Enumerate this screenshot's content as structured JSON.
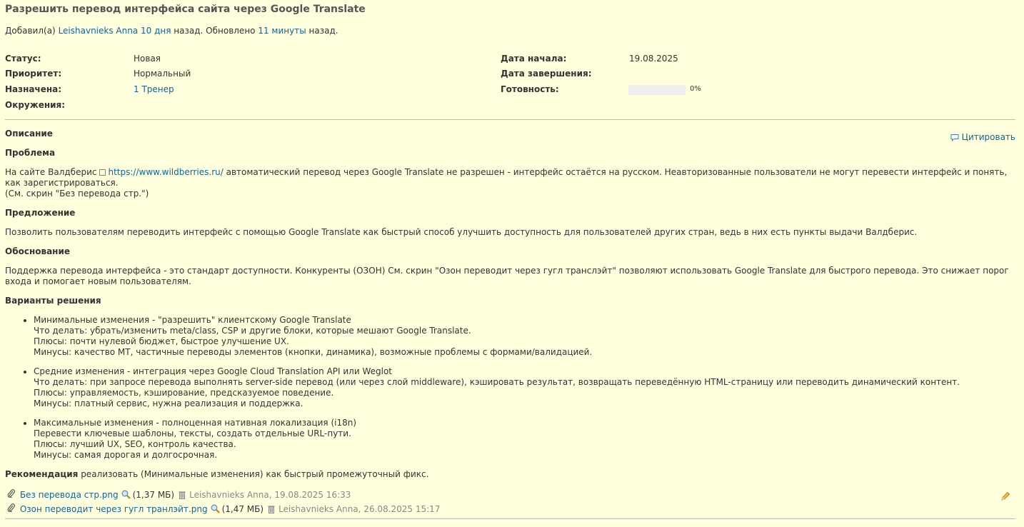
{
  "issue": {
    "subject": "Разрешить перевод интерфейса сайта через Google Translate",
    "author_line": {
      "prefix": "Добавил(а)",
      "author": "Leishavnieks Anna",
      "created_ago": "10 дня",
      "mid": "назад. Обновлено",
      "updated_ago": "11 минуты",
      "suffix": "назад."
    },
    "attributes": {
      "status_label": "Статус:",
      "status_value": "Новая",
      "priority_label": "Приоритет:",
      "priority_value": "Нормальный",
      "assigned_label": "Назначена:",
      "assigned_value": "1 Тренер",
      "environment_label": "Окружения:",
      "start_label": "Дата начала:",
      "start_value": "19.08.2025",
      "due_label": "Дата завершения:",
      "done_label": "Готовность:",
      "done_value": "0%",
      "done_ratio": 0
    },
    "description": {
      "title": "Описание",
      "quote_label": "Цитировать",
      "h_problem": "Проблема",
      "problem_pre": "На сайте Валдберис",
      "problem_link": "https://www.wildberries.ru/",
      "problem_post": "автоматический перевод через Google Translate не разрешен - интерфейс остаётся на русском. Неавторизованные пользователи не могут перевести интерфейс и понять, как зарегистрироваться.",
      "problem_note": "(См. скрин \"Без перевода стр.\")",
      "h_proposal": "Предложение",
      "proposal": "Позволить пользователям переводить интерфейс с помощью Google Translate как быстрый способ улучшить доступность для пользователей других стран, ведь в них есть пункты выдачи Валдберис.",
      "h_rationale": "Обоснование",
      "rationale_1": "Поддержка перевода интерфейса - это стандарт доступности. Конкуренты (ОЗОН) См. скрин \"Озон переводит через гугл транслэйт\" позволяют использовать Google Translate для быстрого перевода. Это снижает порог",
      "rationale_2": "входа и помогает новым пользователям.",
      "h_options": "Варианты решения",
      "options": [
        {
          "line1": "Минимальные изменения - \"разрешить\" клиентскому Google Translate",
          "line2": "Что делать: убрать/изменить meta/class, CSP и другие блоки, которые мешают Google Translate.",
          "line3": "Плюсы: почти нулевой бюджет, быстрое улучшение UX.",
          "line4": "Минусы: качество МТ, частичные переводы элементов (кнопки, динамика), возможные проблемы с формами/валидацией."
        },
        {
          "line1": "Средние изменения - интеграция через Google Cloud Translation API или Weglot",
          "line2": "Что делать: при запросе перевода выполнять server-side перевод (или через слой middleware), кэшировать результат, возвращать переведённую HTML-страницу или переводить динамический контент.",
          "line3": "Плюсы: управляемость, кэширование, предсказуемое поведение.",
          "line4": "Минусы: платный сервис, нужна реализация и поддержка."
        },
        {
          "line1": "Максимальные изменения - полноценная нативная локализация (i18n)",
          "line2": "Перевести ключевые шаблоны, тексты, создать отдельные URL-пути.",
          "line3": "Плюсы: лучший UX, SEO, контроль качества.",
          "line4": "Минусы: самая дорогая и долгосрочная."
        }
      ],
      "recommendation_label": "Рекомендация",
      "recommendation_text": "реализовать (Минимальные изменения) как быстрый промежуточный фикс."
    },
    "attachments": [
      {
        "name": "Без перевода стр.png",
        "size": "(1,37 МБ)",
        "meta": "Leishavnieks Anna, 19.08.2025 16:33"
      },
      {
        "name": "Озон переводит через гугл транлэйт.png",
        "size": "(1,47 МБ)",
        "meta": "Leishavnieks Anna, 26.08.2025 15:17"
      }
    ]
  }
}
